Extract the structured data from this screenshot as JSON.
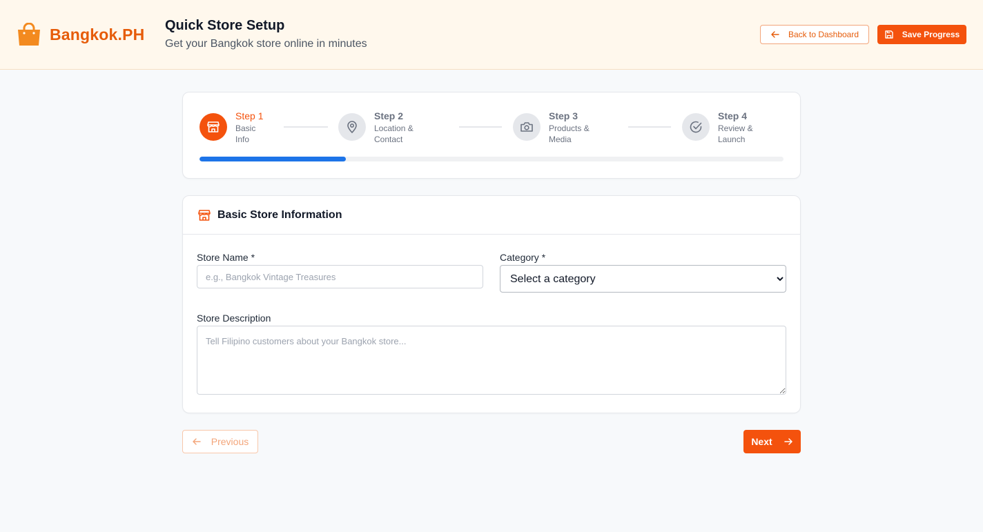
{
  "brand": {
    "name": "Bangkok.PH",
    "icon": "shopping-bag-icon",
    "color": "#e65c0a"
  },
  "header": {
    "title": "Quick Store Setup",
    "subtitle": "Get your Bangkok store online in minutes",
    "back_label": "Back to Dashboard",
    "save_label": "Save Progress"
  },
  "stepper": {
    "progress_fraction": 0.25,
    "steps": [
      {
        "label": "Step 1",
        "sub1": "Basic",
        "sub2": "Info",
        "icon": "store-icon",
        "active": true
      },
      {
        "label": "Step 2",
        "sub1": "Location &",
        "sub2": "Contact",
        "icon": "map-pin-icon",
        "active": false
      },
      {
        "label": "Step 3",
        "sub1": "Products &",
        "sub2": "Media",
        "icon": "camera-icon",
        "active": false
      },
      {
        "label": "Step 4",
        "sub1": "Review &",
        "sub2": "Launch",
        "icon": "check-circle-icon",
        "active": false
      }
    ]
  },
  "form": {
    "title": "Basic Store Information",
    "store_name_label": "Store Name *",
    "store_name_placeholder": "e.g., Bangkok Vintage Treasures",
    "store_name_value": "",
    "category_label": "Category *",
    "category_selected": "Select a category",
    "description_label": "Store Description",
    "description_placeholder": "Tell Filipino customers about your Bangkok store...",
    "description_value": ""
  },
  "nav": {
    "previous_label": "Previous",
    "next_label": "Next"
  },
  "colors": {
    "accent": "#f4520d",
    "progress": "#1d74e8",
    "header_bg": "#fff8ed"
  }
}
